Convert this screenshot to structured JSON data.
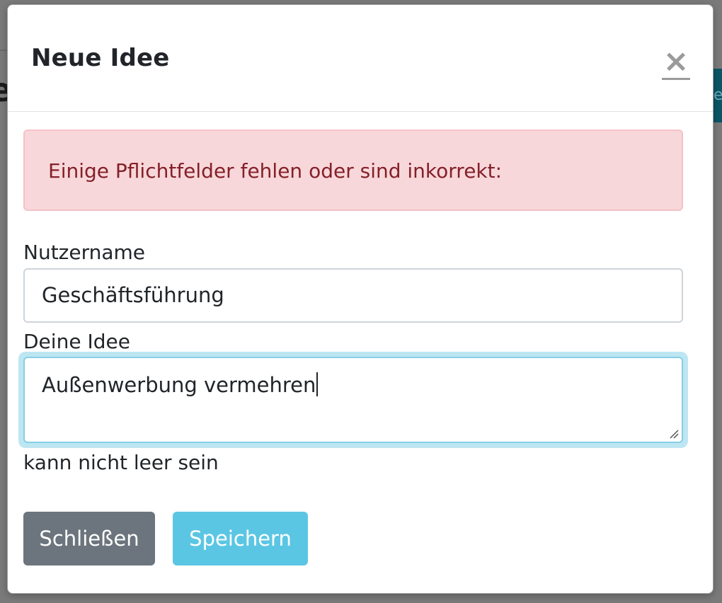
{
  "background": {
    "partial_heading_letter": "e",
    "partial_button_letter": "e"
  },
  "modal": {
    "title": "Neue Idee",
    "close_icon": "×"
  },
  "alert": {
    "message": "Einige Pflichtfelder fehlen oder sind inkorrekt:",
    "colors": {
      "background": "#f8d7da",
      "text": "#842029"
    }
  },
  "form": {
    "username": {
      "label": "Nutzername",
      "value": "Geschäftsführung"
    },
    "idea": {
      "label": "Deine Idee",
      "value": "Außenwerbung vermehren",
      "help_text": "kann nicht leer sein"
    }
  },
  "footer": {
    "close_label": "Schließen",
    "save_label": "Speichern",
    "colors": {
      "close": "#6c757d",
      "save": "#5bc6e4"
    }
  }
}
